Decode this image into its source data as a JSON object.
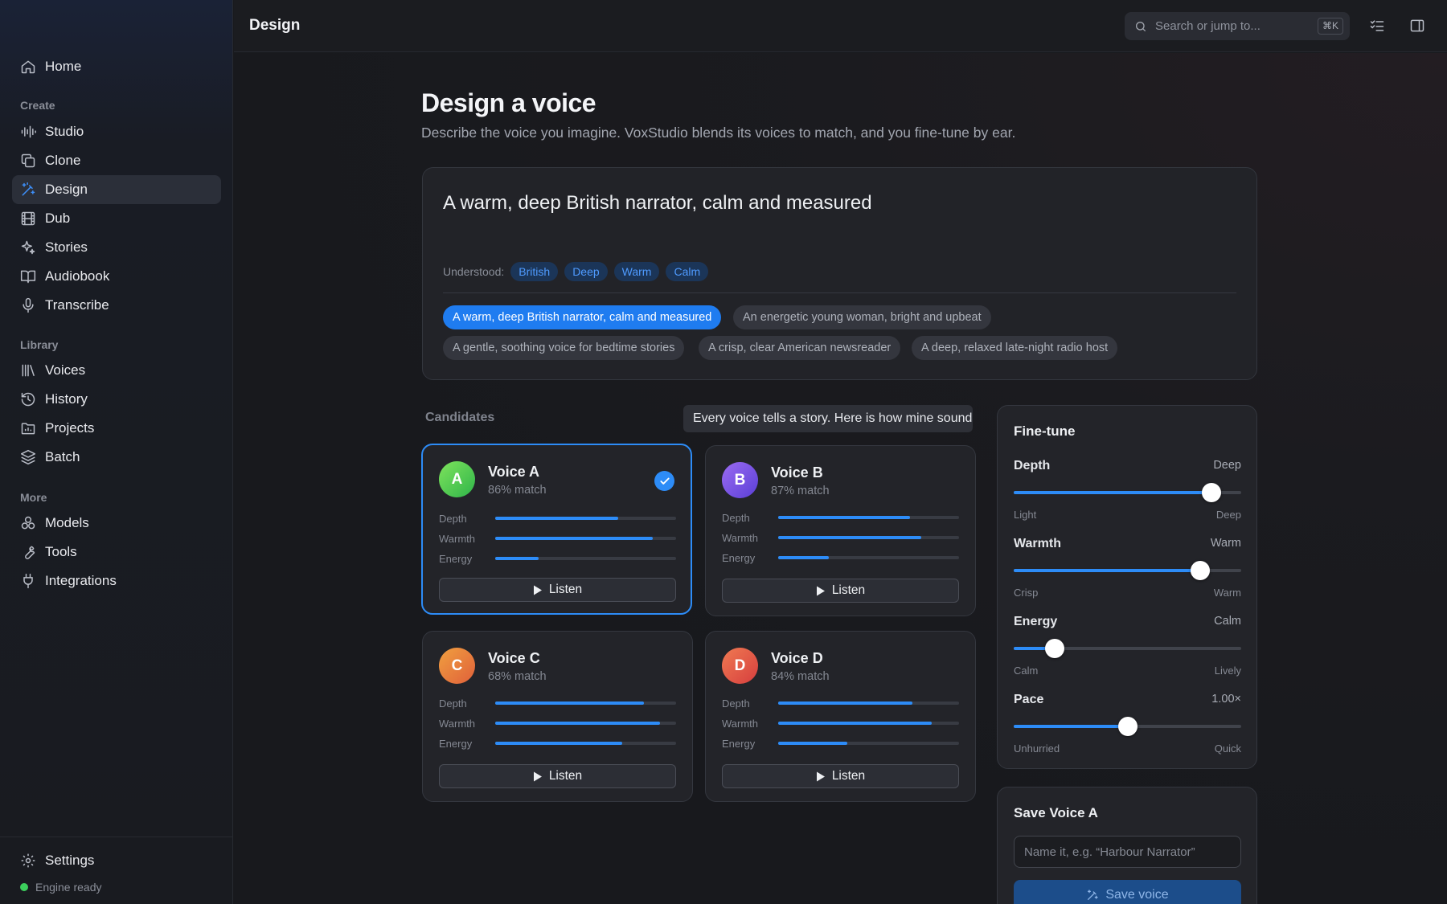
{
  "sidebar": {
    "home": "Home",
    "sections": {
      "create": "Create",
      "library": "Library",
      "more": "More"
    },
    "create_items": [
      "Studio",
      "Clone",
      "Design",
      "Dub",
      "Stories",
      "Audiobook",
      "Transcribe"
    ],
    "library_items": [
      "Voices",
      "History",
      "Projects",
      "Batch"
    ],
    "more_items": [
      "Models",
      "Tools",
      "Integrations"
    ],
    "settings": "Settings",
    "status": "Engine ready",
    "status_color": "#3ccf5c"
  },
  "topbar": {
    "title": "Design",
    "search_placeholder": "Search or jump to...",
    "shortcut": "⌘K"
  },
  "page": {
    "title": "Design a voice",
    "subtitle": "Describe the voice you imagine. VoxStudio blends its voices to match, and you fine-tune by ear."
  },
  "prompt": {
    "text": "A warm, deep British narrator, calm and measured",
    "understood_label": "Understood:",
    "tags": [
      "British",
      "Deep",
      "Warm",
      "Calm"
    ],
    "suggestions": [
      "A warm, deep British narrator, calm and measured",
      "An energetic young woman, bright and upbeat",
      "A gentle, soothing voice for bedtime stories",
      "A crisp, clear American newsreader",
      "A deep, relaxed late-night radio host"
    ]
  },
  "candidates": {
    "label": "Candidates",
    "tooltip": "Every voice tells a story. Here is how mine sounds.",
    "bar_labels": [
      "Depth",
      "Warmth",
      "Energy"
    ],
    "listen_label": "Listen",
    "voices": [
      {
        "initial": "A",
        "name": "Voice A",
        "match": "86% match",
        "levels": [
          0.68,
          0.87,
          0.24
        ],
        "selected": true
      },
      {
        "initial": "B",
        "name": "Voice B",
        "match": "87% match",
        "levels": [
          0.73,
          0.79,
          0.28
        ],
        "selected": false
      },
      {
        "initial": "C",
        "name": "Voice C",
        "match": "68% match",
        "levels": [
          0.82,
          0.91,
          0.7
        ],
        "selected": false
      },
      {
        "initial": "D",
        "name": "Voice D",
        "match": "84% match",
        "levels": [
          0.74,
          0.85,
          0.38
        ],
        "selected": false
      }
    ]
  },
  "finetune": {
    "title": "Fine-tune",
    "sliders": [
      {
        "name": "Depth",
        "value": "Deep",
        "min": "Light",
        "max": "Deep",
        "level": 0.87
      },
      {
        "name": "Warmth",
        "value": "Warm",
        "min": "Crisp",
        "max": "Warm",
        "level": 0.82
      },
      {
        "name": "Energy",
        "value": "Calm",
        "min": "Calm",
        "max": "Lively",
        "level": 0.18
      },
      {
        "name": "Pace",
        "value": "1.00×",
        "min": "Unhurried",
        "max": "Quick",
        "level": 0.5
      }
    ]
  },
  "save": {
    "title": "Save Voice A",
    "placeholder": "Name it, e.g. “Harbour Narrator”",
    "button": "Save voice"
  },
  "colors": {
    "accent": "#2d8cf7"
  }
}
